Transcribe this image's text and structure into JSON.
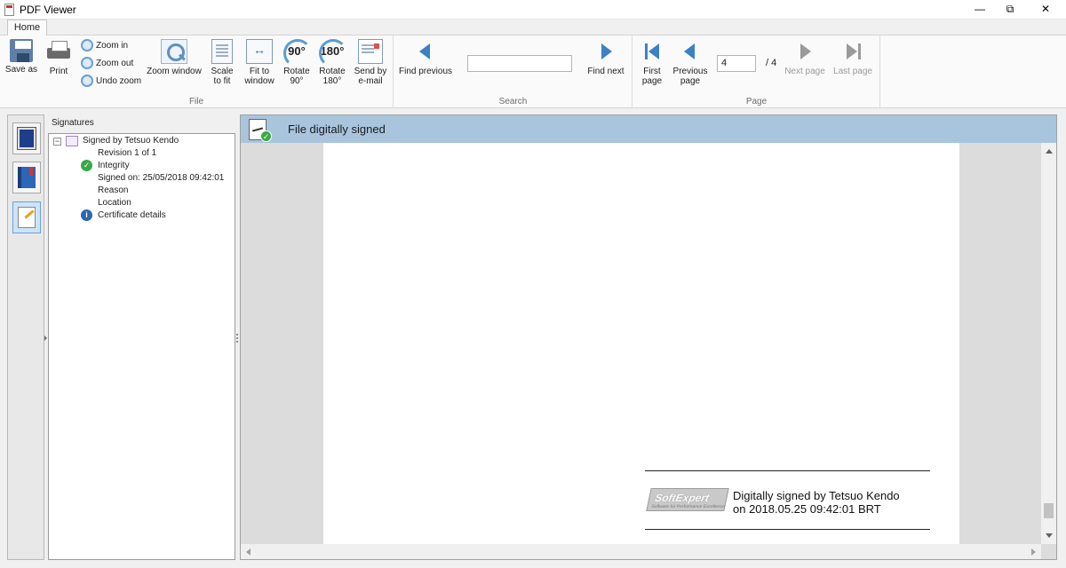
{
  "window": {
    "title": "PDF Viewer",
    "minimize_glyph": "—",
    "maximize_glyph": "⧉",
    "close_glyph": "✕"
  },
  "ribbon": {
    "tab": "Home",
    "file_group": {
      "label": "File",
      "save_as": "Save as",
      "print": "Print",
      "zoom_in": "Zoom in",
      "zoom_out": "Zoom out",
      "undo_zoom": "Undo zoom",
      "zoom_window": "Zoom window",
      "scale_to_fit_1": "Scale",
      "scale_to_fit_2": "to fit",
      "fit_to_window_1": "Fit to",
      "fit_to_window_2": "window",
      "rotate_90_1": "Rotate",
      "rotate_90_2": "90°",
      "rotate_90_badge": "90°",
      "rotate_180_1": "Rotate",
      "rotate_180_2": "180°",
      "rotate_180_badge": "180°",
      "send_email_1": "Send by",
      "send_email_2": "e-mail"
    },
    "search_group": {
      "label": "Search",
      "find_previous": "Find previous",
      "find_next": "Find next",
      "search_value": "",
      "search_placeholder": ""
    },
    "page_group": {
      "label": "Page",
      "first_page_1": "First",
      "first_page_2": "page",
      "previous_page_1": "Previous",
      "previous_page_2": "page",
      "current_page": "4",
      "total_pages": "/ 4",
      "next_page": "Next page",
      "last_page": "Last page"
    }
  },
  "signatures_panel": {
    "title": "Signatures",
    "expander_glyph": "−",
    "signer": "Signed by Tetsuo Kendo",
    "revision": "Revision 1 of 1",
    "integrity": "Integrity",
    "signed_on": "Signed on: 25/05/2018 09:42:01",
    "reason": "Reason",
    "location": "Location",
    "certificate_details": "Certificate details",
    "check_glyph": "✓",
    "info_glyph": "i"
  },
  "document": {
    "banner_text": "File digitally signed",
    "check_glyph": "✓",
    "stamp_logo": "SoftExpert",
    "stamp_logo_tagline": "Software for Performance Excellence",
    "stamp_line1": "Digitally signed by Tetsuo Kendo",
    "stamp_line2": "on 2018.05.25 09:42:01 BRT"
  },
  "icons": {
    "save": "save-icon",
    "print": "printer-icon",
    "zoom_in": "zoom-in-icon",
    "zoom_out": "zoom-out-icon",
    "undo_zoom": "undo-zoom-icon",
    "zoom_window": "zoom-window-icon",
    "scale": "scale-to-fit-icon",
    "fit": "fit-to-window-icon",
    "rotate90": "rotate-90-icon",
    "rotate180": "rotate-180-icon",
    "email": "email-icon",
    "find_prev": "arrow-left-icon",
    "find_next": "arrow-right-icon",
    "first": "first-page-icon",
    "prev": "previous-page-icon",
    "next": "next-page-icon",
    "last": "last-page-icon"
  },
  "colors": {
    "banner": "#a9c5de",
    "accent": "#3b82c4",
    "success": "#3aa845",
    "info": "#2a65b3"
  }
}
